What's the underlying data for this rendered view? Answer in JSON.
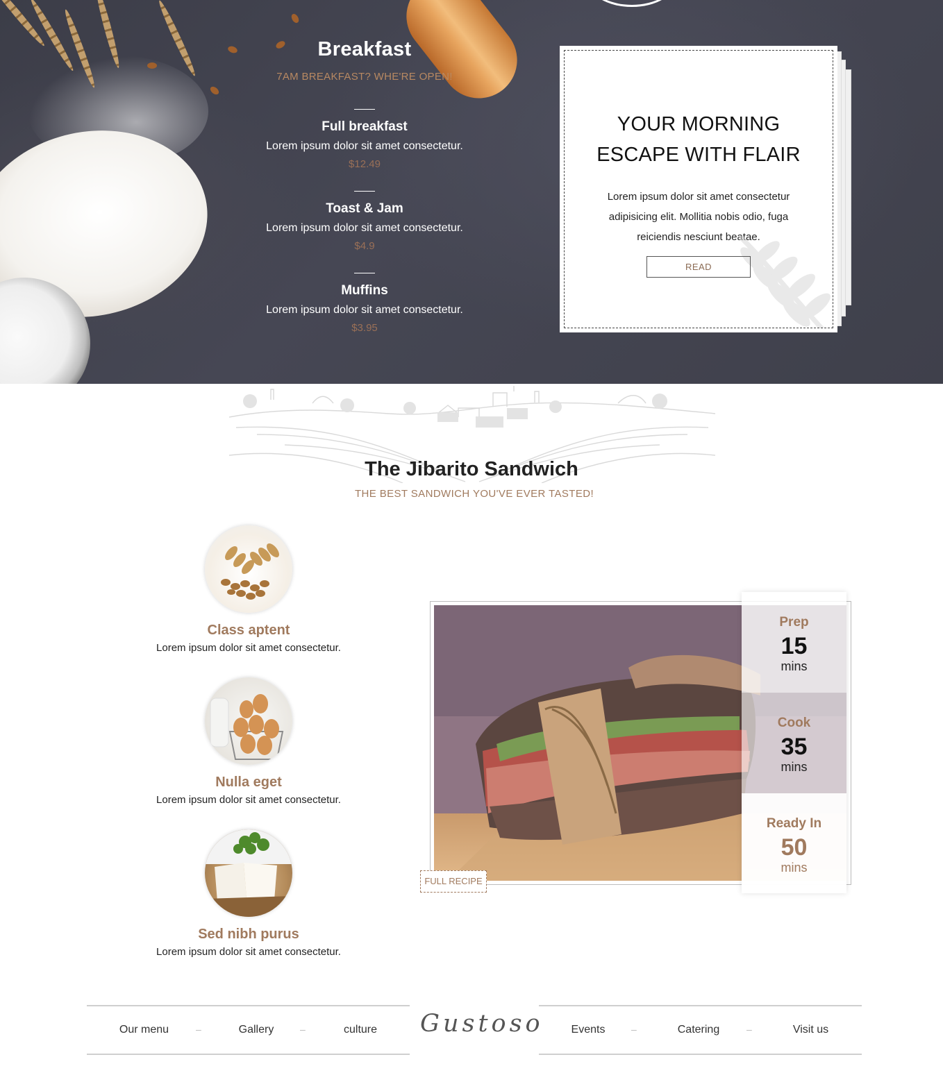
{
  "breakfast_menu": {
    "title": "Breakfast",
    "subtitle": "7AM BREAKFAST? WHE'RE OPEN!",
    "items": [
      {
        "name": "Full breakfast",
        "description": "Lorem ipsum dolor sit amet consectetur.",
        "price": "$12.49"
      },
      {
        "name": "Toast & Jam",
        "description": "Lorem ipsum dolor sit amet consectetur.",
        "price": "$4.9"
      },
      {
        "name": "Muffins",
        "description": "Lorem ipsum dolor sit amet consectetur.",
        "price": "$3.95"
      }
    ]
  },
  "promo_card": {
    "title_line1": "YOUR MORNING",
    "title_line2": "ESCAPE WITH FLAIR",
    "text": "Lorem ipsum dolor sit amet consectetur adipisicing elit. Mollitia nobis odio, fuga reiciendis nesciunt beatae.",
    "button_label": "READ"
  },
  "recipe_section": {
    "title": "The Jibarito Sandwich",
    "subtitle": "THE BEST SANDWICH YOU'VE EVER TASTED!",
    "features": [
      {
        "name": "Class aptent",
        "description": "Lorem ipsum dolor sit amet consectetur.",
        "icon": "wheat-grain-photo"
      },
      {
        "name": "Nulla eget",
        "description": "Lorem ipsum dolor sit amet consectetur.",
        "icon": "eggs-photo"
      },
      {
        "name": "Sed nibh purus",
        "description": "Lorem ipsum dolor sit amet consectetur.",
        "icon": "cheese-photo"
      }
    ],
    "full_recipe_label": "FULL RECIPE",
    "times": [
      {
        "label": "Prep",
        "value": "15",
        "unit": "mins"
      },
      {
        "label": "Cook",
        "value": "35",
        "unit": "mins"
      },
      {
        "label": "Ready In",
        "value": "50",
        "unit": "mins"
      }
    ]
  },
  "footer_nav": {
    "left": [
      "Our menu",
      "Gallery",
      "culture"
    ],
    "logo": "Gustoso",
    "right": [
      "Events",
      "Catering",
      "Visit us"
    ],
    "separator": "–"
  },
  "colors": {
    "accent": "#a07a5e",
    "hero_background": "#42434f",
    "price": "#9a7057"
  }
}
